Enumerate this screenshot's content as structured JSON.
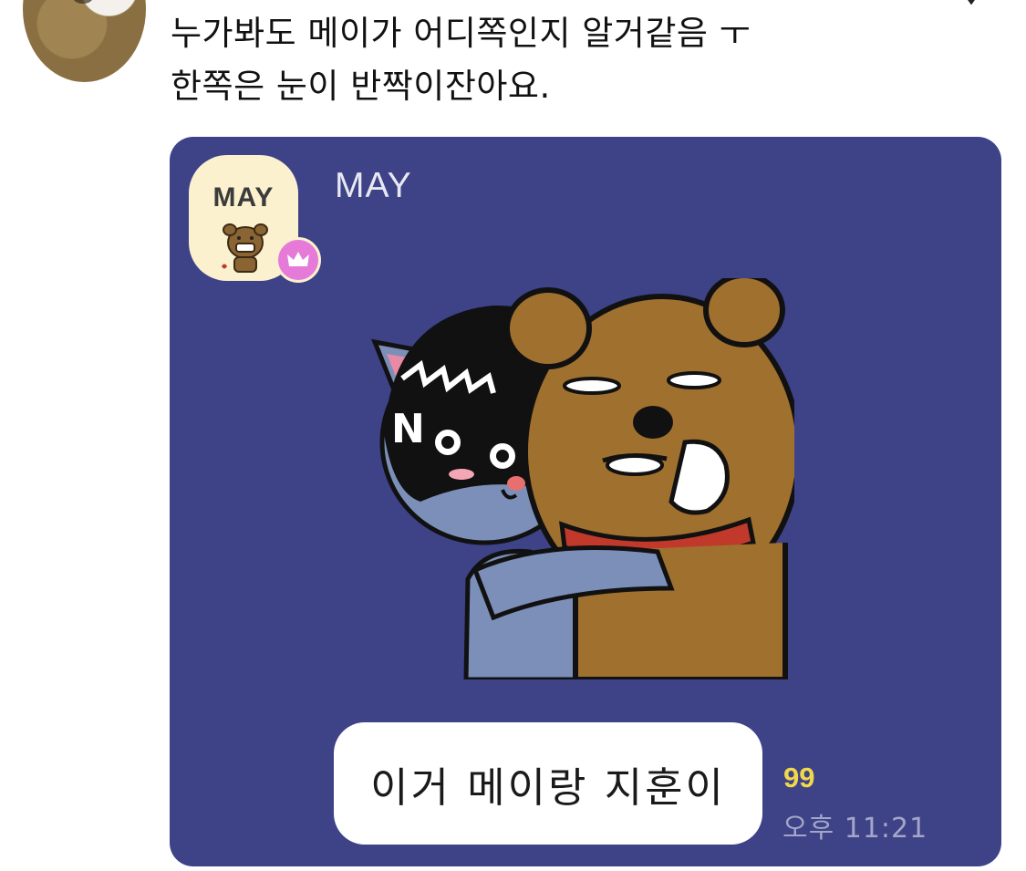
{
  "tweet": {
    "line1": "누가봐도 메이가 어디쪽인지 알거같음 ㅜ",
    "line2": "한쪽은 눈이 반짝이잔아요."
  },
  "chat": {
    "profile_label": "MAY",
    "sender_name": "MAY",
    "message": "이거 메이랑 지훈이",
    "unread_count": "99",
    "timestamp": "오후 11:21",
    "colors": {
      "background": "#3e4287",
      "bubble": "#ffffff",
      "unread": "#f0d84a",
      "timestamp": "#a3a6c8",
      "badge": "#e67ad8"
    }
  },
  "icons": {
    "more": "more-icon",
    "crown": "crown-icon",
    "sticker": "sticker-image"
  }
}
